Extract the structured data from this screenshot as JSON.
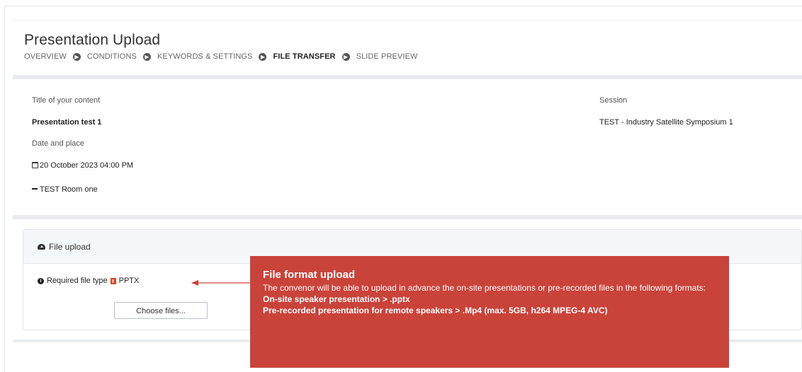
{
  "page_title": "Presentation Upload",
  "steps": [
    {
      "label": "OVERVIEW",
      "active": false
    },
    {
      "label": "CONDITIONS",
      "active": false
    },
    {
      "label": "KEYWORDS & SETTINGS",
      "active": false
    },
    {
      "label": "FILE TRANSFER",
      "active": true
    },
    {
      "label": "SLIDE PREVIEW",
      "active": false
    }
  ],
  "info": {
    "title_label": "Title of your content",
    "title_value": "Presentation test 1",
    "date_label": "Date and place",
    "date_value": "20 October 2023 04:00 PM",
    "room_value": "TEST Room one",
    "session_label": "Session",
    "session_value": "TEST - Industry Satellite Symposium 1"
  },
  "upload": {
    "title": "File upload",
    "required_label": "Required file type",
    "required_type": "PPTX",
    "choose_button": "Choose files..."
  },
  "callout": {
    "title": "File format upload",
    "body": "The convenor will be able to upload in advance the on-site presentations or pre-recorded files in the following formats:",
    "line1": "On-site speaker presentation > .pptx",
    "line2": "Pre-recorded presentation for remote speakers > .Mp4 (max. 5GB, h264 MPEG-4 AVC)",
    "color": "#c9433a"
  }
}
